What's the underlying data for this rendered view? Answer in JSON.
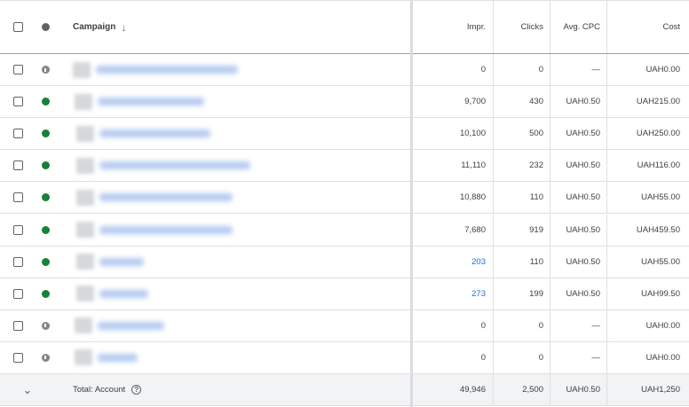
{
  "header": {
    "campaign": "Campaign",
    "sort_arrow": "↓",
    "impr": "Impr.",
    "clicks": "Clicks",
    "avg_cpc": "Avg. CPC",
    "cost": "Cost"
  },
  "rows": [
    {
      "status": "paused",
      "impr": "0",
      "impr_link": false,
      "clicks": "0",
      "cpc": "—",
      "cost": "UAH0.00"
    },
    {
      "status": "enabled",
      "impr": "9,700",
      "impr_link": false,
      "clicks": "430",
      "cpc": "UAH0.50",
      "cost": "UAH215.00"
    },
    {
      "status": "enabled",
      "impr": "10,100",
      "impr_link": false,
      "clicks": "500",
      "cpc": "UAH0.50",
      "cost": "UAH250.00"
    },
    {
      "status": "enabled",
      "impr": "11,110",
      "impr_link": false,
      "clicks": "232",
      "cpc": "UAH0.50",
      "cost": "UAH116.00"
    },
    {
      "status": "enabled",
      "impr": "10,880",
      "impr_link": false,
      "clicks": "110",
      "cpc": "UAH0.50",
      "cost": "UAH55.00"
    },
    {
      "status": "enabled",
      "impr": "7,680",
      "impr_link": false,
      "clicks": "919",
      "cpc": "UAH0.50",
      "cost": "UAH459.50"
    },
    {
      "status": "enabled",
      "impr": "203",
      "impr_link": true,
      "clicks": "110",
      "cpc": "UAH0.50",
      "cost": "UAH55.00"
    },
    {
      "status": "enabled",
      "impr": "273",
      "impr_link": true,
      "clicks": "199",
      "cpc": "UAH0.50",
      "cost": "UAH99.50"
    },
    {
      "status": "paused",
      "impr": "0",
      "impr_link": false,
      "clicks": "0",
      "cpc": "—",
      "cost": "UAH0.00"
    },
    {
      "status": "paused",
      "impr": "0",
      "impr_link": false,
      "clicks": "0",
      "cpc": "—",
      "cost": "UAH0.00"
    }
  ],
  "total": {
    "chevron": "⌄",
    "label": "Total: Account",
    "help": "?",
    "impr": "49,946",
    "clicks": "2,500",
    "cpc": "UAH0.50",
    "cost": "UAH1,250"
  },
  "colors": {
    "enabled": "#188038",
    "paused": "#80868b",
    "link": "#1a73e8"
  }
}
